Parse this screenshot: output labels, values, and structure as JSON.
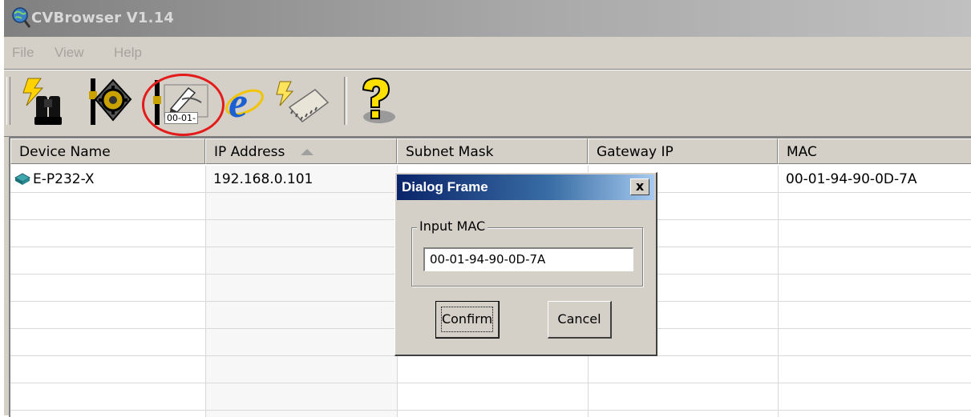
{
  "window": {
    "title": "CVBrowser V1.14",
    "app_icon": "globe-magnifier-icon"
  },
  "menu": {
    "items": [
      {
        "label": "File"
      },
      {
        "label": "View"
      },
      {
        "label": "Help"
      }
    ]
  },
  "toolbar": {
    "buttons": [
      {
        "icon": "search-devices-binoculars-icon"
      },
      {
        "icon": "device-settings-icon"
      },
      {
        "icon": "change-mac-icon",
        "label": "00-01-",
        "highlighted": true
      },
      {
        "icon": "internet-explorer-icon"
      },
      {
        "icon": "firmware-update-chip-icon"
      },
      {
        "icon": "help-icon"
      }
    ],
    "highlight_color": "#e31b1b"
  },
  "table": {
    "columns": [
      "Device Name",
      "IP Address",
      "Subnet Mask",
      "Gateway IP",
      "MAC"
    ],
    "sorted_column": "IP Address",
    "rows": [
      {
        "device_name": "E-P232-X",
        "ip_address": "192.168.0.101",
        "subnet_mask": "",
        "gateway_ip": "",
        "mac": "00-01-94-90-0D-7A",
        "icon": "network-device-icon"
      }
    ]
  },
  "dialog": {
    "title": "Dialog Frame",
    "close_label": "x",
    "group_label": "Input MAC",
    "input_value": "00-01-94-90-0D-7A",
    "confirm_label": "Confirm",
    "cancel_label": "Cancel"
  },
  "colors": {
    "window_face": "#d4d0c8",
    "dialog_title_start": "#0a246a",
    "dialog_title_end": "#a6caf0"
  }
}
